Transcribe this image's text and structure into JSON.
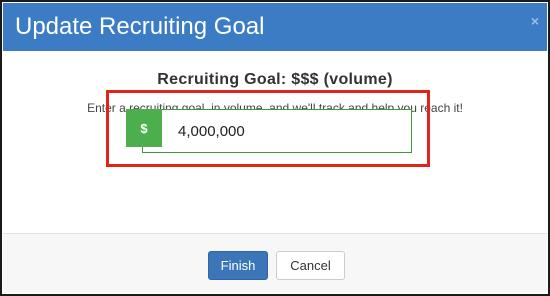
{
  "dialog": {
    "title": "Update Recruiting Goal",
    "close_icon": "×"
  },
  "body": {
    "heading": "Recruiting Goal: $$$ (volume)",
    "description": "Enter a recruiting goal, in volume, and we'll track and help you reach it!"
  },
  "goal_input": {
    "addon": "$",
    "value": "4,000,000"
  },
  "footer": {
    "finish_label": "Finish",
    "cancel_label": "Cancel"
  },
  "colors": {
    "header_bg": "#3c7cc4",
    "addon_bg": "#4cae4c",
    "highlight_border": "#e12419",
    "primary_button": "#3a76b8"
  },
  "icons": {
    "close": "close-icon",
    "currency": "dollar-icon"
  }
}
